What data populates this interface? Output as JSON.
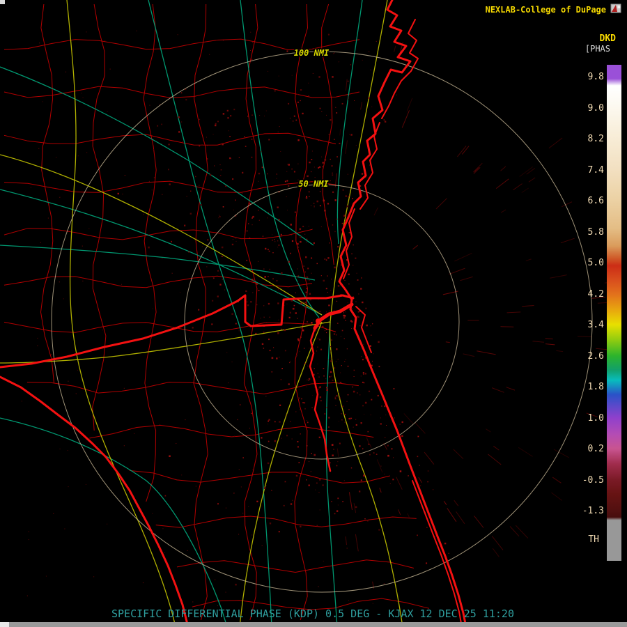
{
  "header": {
    "brand": "NEXLAB-College of DuPage"
  },
  "product": {
    "code": "DKD",
    "units": "[PHAS"
  },
  "colorbar": {
    "ticks": [
      "9.8",
      "9.0",
      "8.2",
      "7.4",
      "6.6",
      "5.8",
      "5.0",
      "4.2",
      "3.4",
      "2.6",
      "1.8",
      "1.0",
      "0.2",
      "-0.5",
      "-1.3"
    ],
    "threshold_label": "TH",
    "gradient_stops": [
      [
        "#9a50d8",
        0
      ],
      [
        "#9a50d8",
        2.8
      ],
      [
        "#ffffff",
        4.2
      ],
      [
        "#fdfbf5",
        7
      ],
      [
        "#f8eed9",
        14
      ],
      [
        "#f2e0c1",
        21
      ],
      [
        "#ecd2a5",
        27
      ],
      [
        "#e4bd85",
        33
      ],
      [
        "#da9c5c",
        36.5
      ],
      [
        "#cf5a28",
        39
      ],
      [
        "#cc2d16",
        40.5
      ],
      [
        "#d94f1d",
        43.5
      ],
      [
        "#e2701c",
        46.2
      ],
      [
        "#e8a80e",
        49.5
      ],
      [
        "#e8e000",
        52.4
      ],
      [
        "#90cc10",
        55.5
      ],
      [
        "#2cb42c",
        58.7
      ],
      [
        "#12a06a",
        61.5
      ],
      [
        "#08bdbd",
        63.6
      ],
      [
        "#2a52c8",
        66.5
      ],
      [
        "#9040cc",
        71.2
      ],
      [
        "#b44cb4",
        74.5
      ],
      [
        "#c85490",
        77.4
      ],
      [
        "#a02c4c",
        80.5
      ],
      [
        "#7a1a26",
        83.7
      ],
      [
        "#671313",
        86.5
      ],
      [
        "#521010",
        89.9
      ],
      [
        "#470d0d",
        91.2
      ],
      [
        "#989898",
        91.8
      ],
      [
        "#989898",
        100
      ]
    ]
  },
  "map": {
    "range_rings": {
      "outer_label": "100 NMI",
      "inner_label": "50 NMI"
    }
  },
  "status_bar": {
    "text": "SPECIFIC DIFFERENTIAL PHASE (KDP) 0.5 DEG - KJAX 12 DEC 25 11:20"
  },
  "colors": {
    "accent_yellow": "#f5d800",
    "units_gray": "#dcdcdc",
    "tick_label": "#f4ddb5",
    "status_teal": "#2f9f9f",
    "coast_red": "#f31111",
    "county_red": "#b20000",
    "road_yellow": "#b9b900",
    "road_teal": "#00a077",
    "ring": "#c7b695",
    "ring_label": "#d8d800",
    "echo_palette": [
      "#4a0404",
      "#5e0606",
      "#730808",
      "#8a0a0a",
      "#9d0e0e"
    ]
  }
}
